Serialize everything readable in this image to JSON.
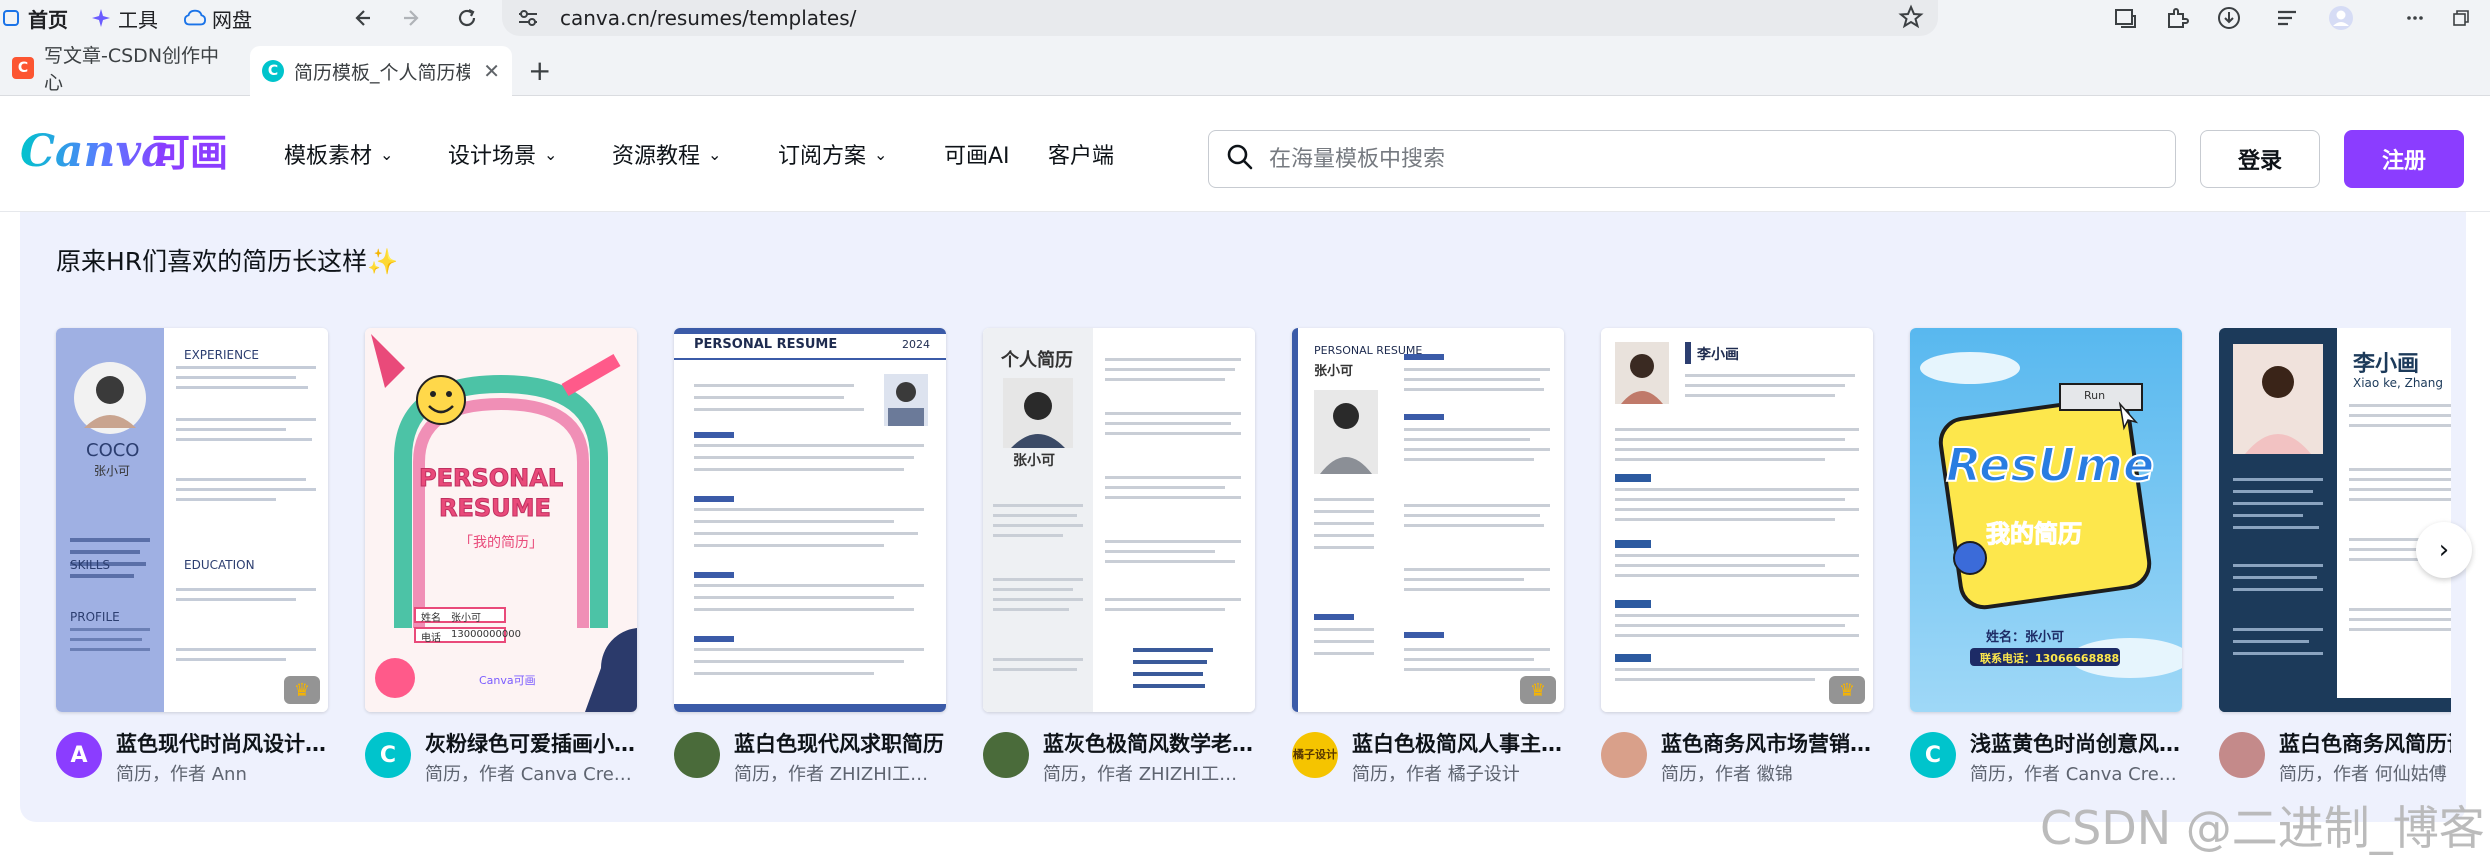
{
  "browser": {
    "home_label": "首页",
    "tools_label": "工具",
    "pan_label": "网盘",
    "url": "canva.cn/resumes/templates/"
  },
  "tabs": [
    {
      "label": "写文章-CSDN创作中心"
    },
    {
      "label": "简历模板_个人简历模"
    }
  ],
  "header": {
    "nav": [
      "模板素材",
      "设计场景",
      "资源教程",
      "订阅方案",
      "可画AI",
      "客户端"
    ],
    "search_placeholder": "在海量模板中搜索",
    "login_label": "登录",
    "signup_label": "注册"
  },
  "section": {
    "title": "原来HR们喜欢的简历长这样✨"
  },
  "cards": [
    {
      "title": "蓝色现代时尚风设计...",
      "sub": "简历，作者 Ann",
      "avatar_letter": "A",
      "avatar_color": "#8b3dff"
    },
    {
      "title": "灰粉绿色可爱插画小...",
      "sub": "简历，作者 Canva Crea...",
      "avatar_letter": "C",
      "avatar_color": "#00c4cc"
    },
    {
      "title": "蓝白色现代风求职简历",
      "sub": "简历，作者 ZHIZHI工作室",
      "avatar_letter": "",
      "avatar_color": "#4a6b3a"
    },
    {
      "title": "蓝灰色极简风数学老...",
      "sub": "简历，作者 ZHIZHI工作室",
      "avatar_letter": "",
      "avatar_color": "#4a6b3a"
    },
    {
      "title": "蓝白色极简风人事主...",
      "sub": "简历，作者 橘子设计",
      "avatar_letter": "橘子设计",
      "avatar_color": "#f5c400"
    },
    {
      "title": "蓝色商务风市场营销...",
      "sub": "简历，作者 徽锦",
      "avatar_letter": "",
      "avatar_color": "#d9a08a"
    },
    {
      "title": "浅蓝黄色时尚创意风...",
      "sub": "简历，作者 Canva Crea...",
      "avatar_letter": "C",
      "avatar_color": "#00c4cc"
    },
    {
      "title": "蓝白色商务风简历设",
      "sub": "简历，作者 何仙姑傅",
      "avatar_letter": "",
      "avatar_color": "#c48a8a"
    }
  ],
  "thumbs": {
    "t1": {
      "name": "COCO",
      "cn": "张小可",
      "exp": "EXPERIENCE",
      "edu": "EDUCATION",
      "skills": "SKILLS",
      "profile": "PROFILE"
    },
    "t2": {
      "title1": "PERSONAL",
      "title2": "RESUME",
      "sub": "「我的简历」",
      "name_label": "姓名",
      "name_val": "张小可",
      "tel_label": "电话",
      "tel_val": "13000000000",
      "brand": "Canva可画"
    },
    "t3": {
      "title": "PERSONAL RESUME",
      "year": "2024"
    },
    "t4": {
      "title": "个人简历",
      "name": "张小可"
    },
    "t5": {
      "title": "PERSONAL RESUME",
      "name": "张小可"
    },
    "t6": {
      "name": "李小画"
    },
    "t7": {
      "title": "ResUme",
      "sub": "我的简历",
      "run": "Run",
      "name": "姓名：张小可",
      "tel": "联系电话：13066668888"
    },
    "t8": {
      "name": "李小画",
      "en": "Xiao ke, Zhang"
    }
  },
  "watermark": "CSDN @二进制_博客",
  "colors": {
    "accent": "#8b3dff",
    "panel_bg": "#eef1fd"
  }
}
